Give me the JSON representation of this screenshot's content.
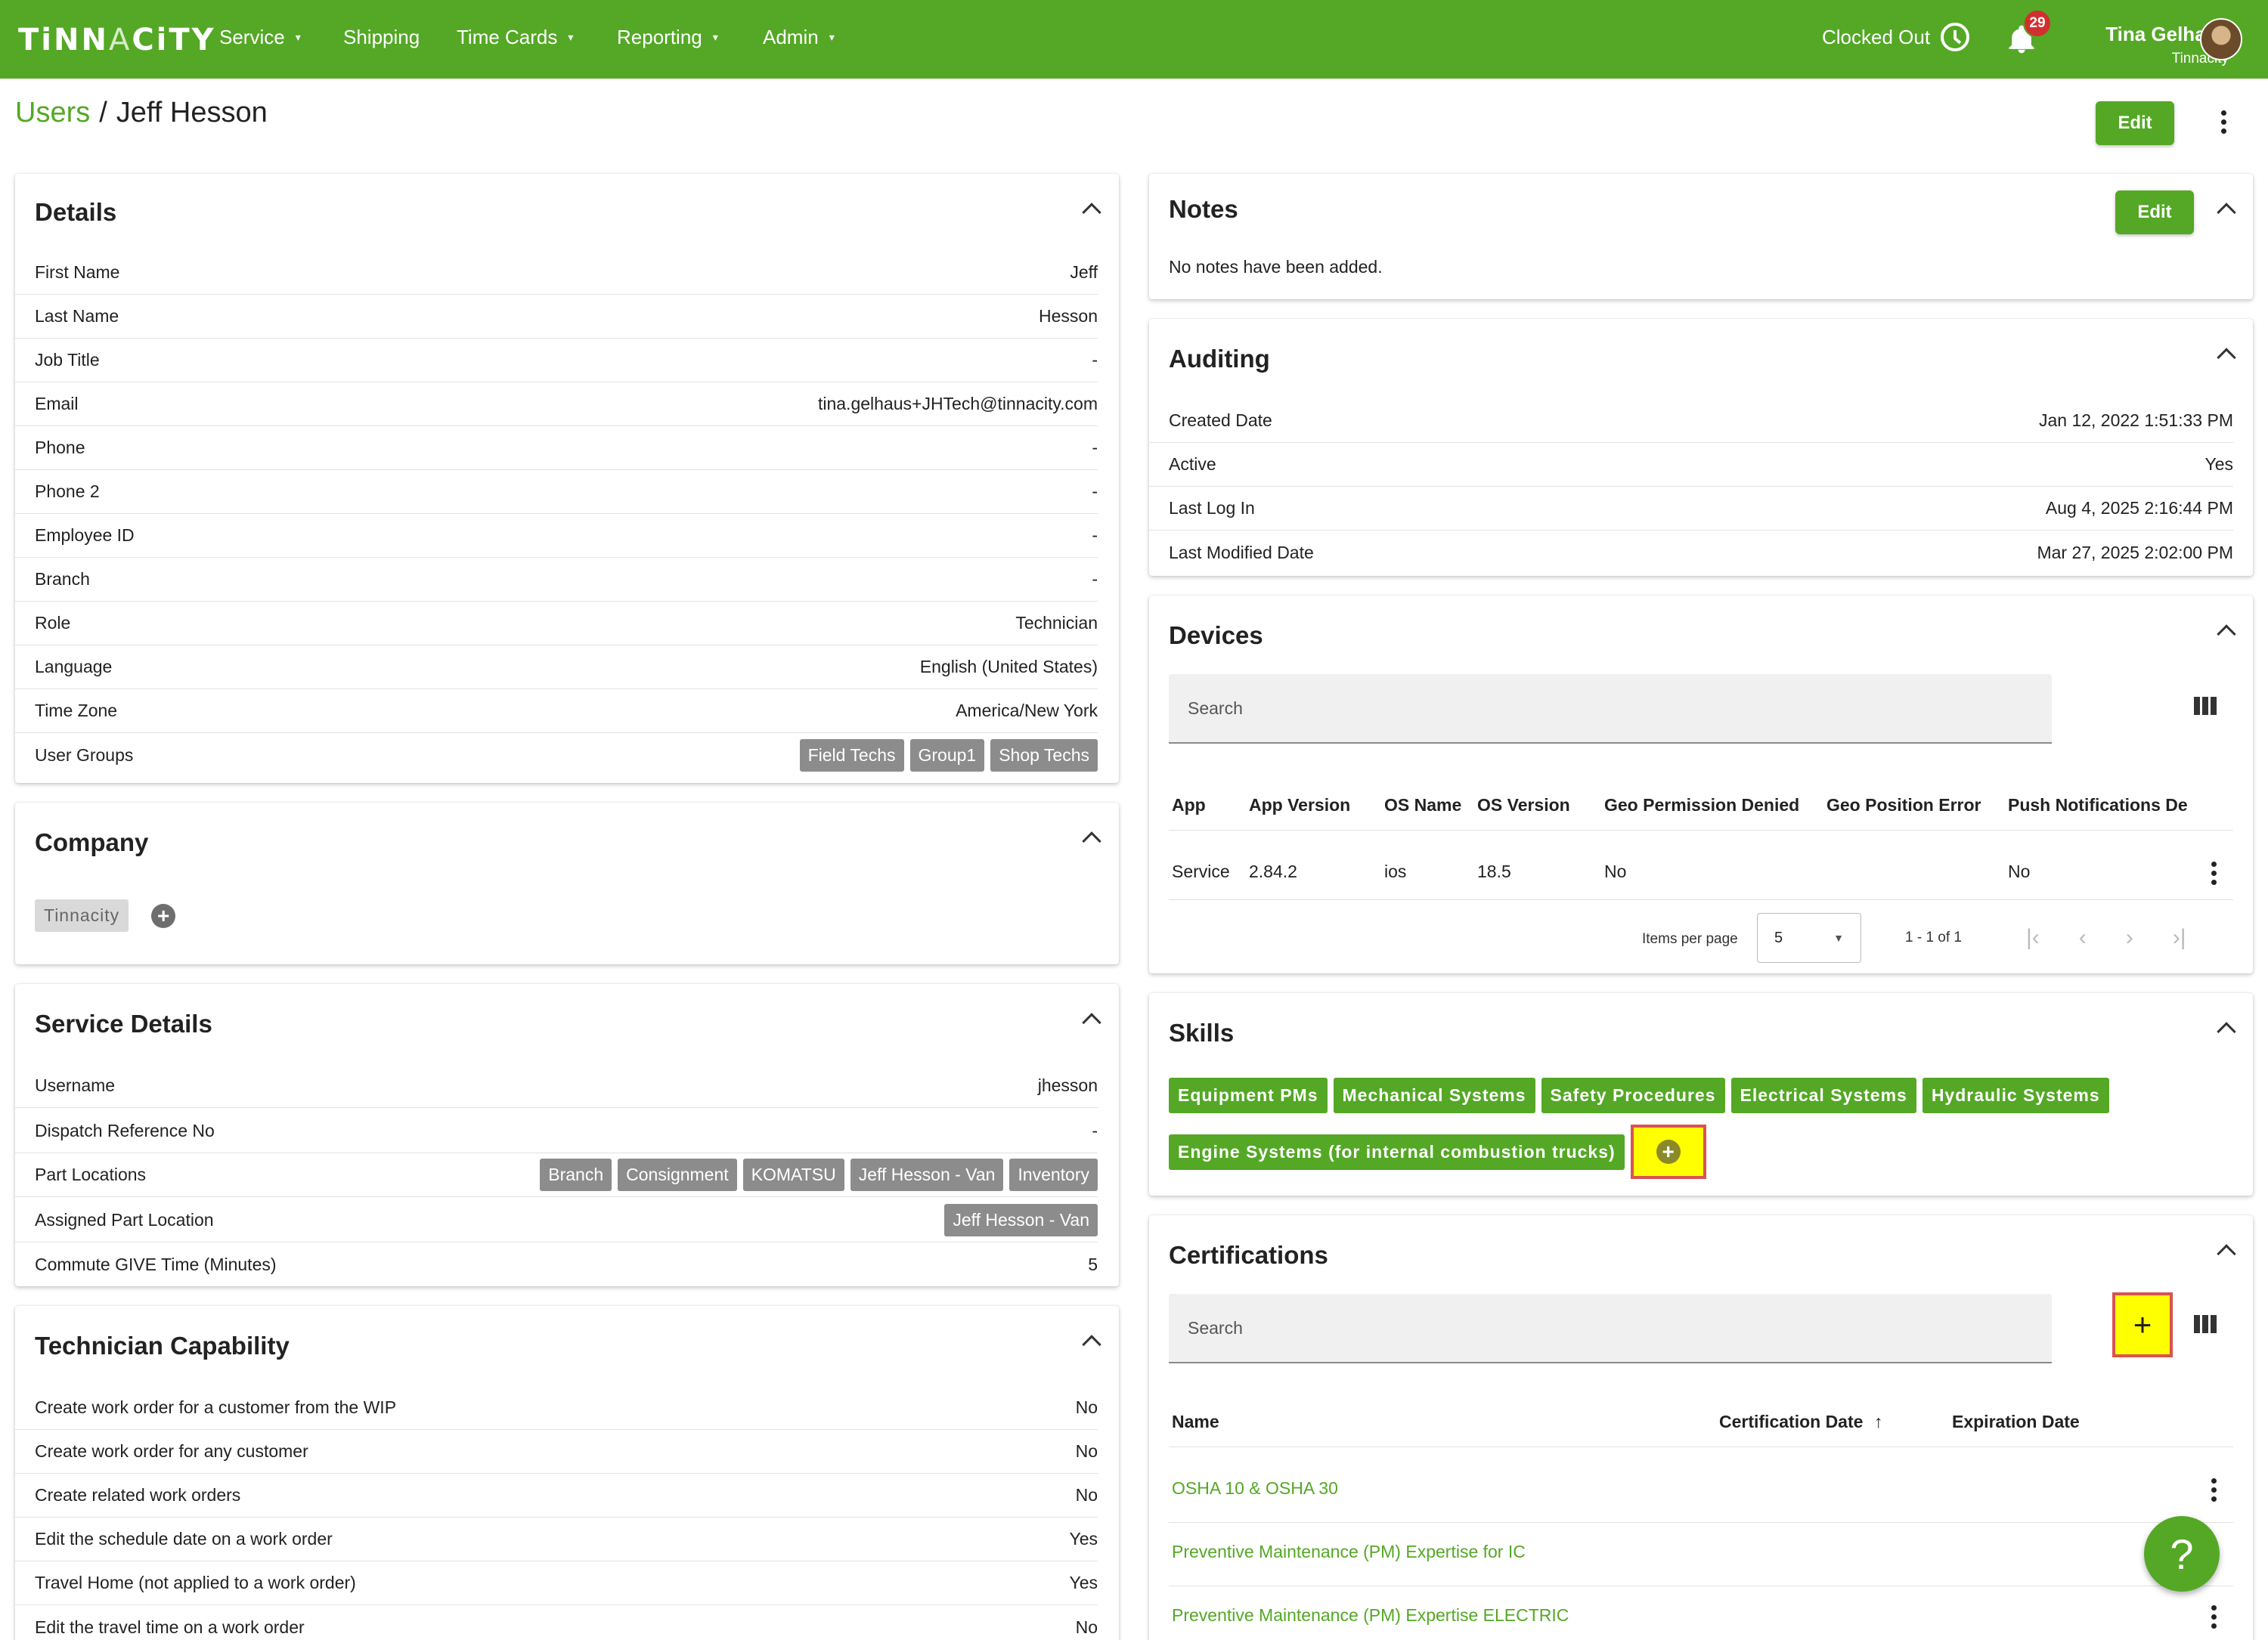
{
  "app": {
    "logo_primary": "TiNNACiTY",
    "nav": [
      "Service",
      "Shipping",
      "Time Cards",
      "Reporting",
      "Admin"
    ],
    "clocked_status": "Clocked Out",
    "notification_count": "29",
    "user_name": "Tina Gelhaus",
    "user_org": "Tinnacity",
    "brand_color": "#54a825"
  },
  "breadcrumb": {
    "parent": "Users",
    "separator": "/",
    "current": "Jeff Hesson"
  },
  "header": {
    "edit_label": "Edit"
  },
  "details": {
    "title": "Details",
    "rows": [
      {
        "label": "First Name",
        "value": "Jeff"
      },
      {
        "label": "Last Name",
        "value": "Hesson"
      },
      {
        "label": "Job Title",
        "value": "-"
      },
      {
        "label": "Email",
        "value": "tina.gelhaus+JHTech@tinnacity.com"
      },
      {
        "label": "Phone",
        "value": "-"
      },
      {
        "label": "Phone 2",
        "value": "-"
      },
      {
        "label": "Employee ID",
        "value": "-"
      },
      {
        "label": "Branch",
        "value": "-"
      },
      {
        "label": "Role",
        "value": "Technician"
      },
      {
        "label": "Language",
        "value": "English (United States)"
      },
      {
        "label": "Time Zone",
        "value": "America/New York"
      }
    ],
    "user_groups_label": "User Groups",
    "user_groups": [
      "Field Techs",
      "Group1",
      "Shop Techs"
    ]
  },
  "company": {
    "title": "Company",
    "chip": "Tinnacity"
  },
  "service_details": {
    "title": "Service Details",
    "rows": [
      {
        "label": "Username",
        "value": "jhesson"
      },
      {
        "label": "Dispatch Reference No",
        "value": "-"
      }
    ],
    "part_locations_label": "Part Locations",
    "part_locations": [
      "Branch",
      "Consignment",
      "KOMATSU",
      "Jeff Hesson - Van",
      "Inventory"
    ],
    "assigned_label": "Assigned Part Location",
    "assigned_value": "Jeff Hesson - Van",
    "commute_label": "Commute GIVE Time (Minutes)",
    "commute_value": "5"
  },
  "technician": {
    "title": "Technician Capability",
    "rows": [
      {
        "label": "Create work order for a customer from the WIP",
        "value": "No"
      },
      {
        "label": "Create work order for any customer",
        "value": "No"
      },
      {
        "label": "Create related work orders",
        "value": "No"
      },
      {
        "label": "Edit the schedule date on a work order",
        "value": "Yes"
      },
      {
        "label": "Travel Home (not applied to a work order)",
        "value": "Yes"
      },
      {
        "label": "Edit the travel time on a work order",
        "value": "No"
      }
    ]
  },
  "notes": {
    "title": "Notes",
    "edit_label": "Edit",
    "empty_text": "No notes have been added."
  },
  "auditing": {
    "title": "Auditing",
    "rows": [
      {
        "label": "Created Date",
        "value": "Jan 12, 2022 1:51:33 PM"
      },
      {
        "label": "Active",
        "value": "Yes"
      },
      {
        "label": "Last Log In",
        "value": "Aug 4, 2025 2:16:44 PM"
      },
      {
        "label": "Last Modified Date",
        "value": "Mar 27, 2025 2:02:00 PM"
      }
    ]
  },
  "devices": {
    "title": "Devices",
    "search_placeholder": "Search",
    "columns": [
      "App",
      "App Version",
      "OS Name",
      "OS Version",
      "Geo Permission Denied",
      "Geo Position Error",
      "Push Notifications De"
    ],
    "row": [
      "Service",
      "2.84.2",
      "ios",
      "18.5",
      "No",
      "",
      "No"
    ],
    "items_per_page_label": "Items per page",
    "items_per_page": "5",
    "range": "1 - 1 of 1"
  },
  "skills": {
    "title": "Skills",
    "chips": [
      "Equipment PMs",
      "Mechanical Systems",
      "Safety Procedures",
      "Electrical Systems",
      "Hydraulic Systems",
      "Engine Systems (for internal combustion trucks)"
    ]
  },
  "certifications": {
    "title": "Certifications",
    "search_placeholder": "Search",
    "columns": [
      "Name",
      "Certification Date",
      "Expiration Date"
    ],
    "rows": [
      "OSHA 10 & OSHA 30",
      "Preventive Maintenance (PM) Expertise for IC",
      "Preventive Maintenance (PM) Expertise ELECTRIC"
    ]
  },
  "help_label": "?"
}
